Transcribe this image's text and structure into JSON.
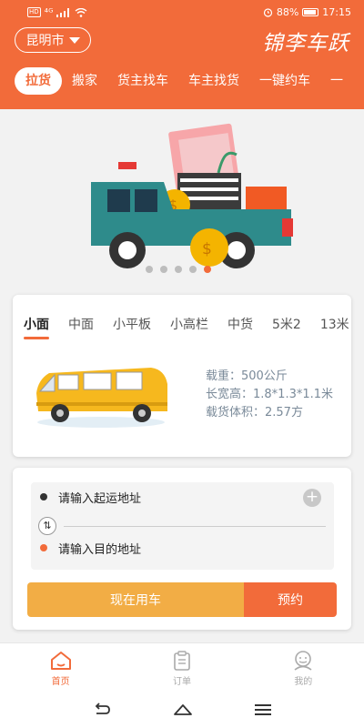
{
  "status_bar": {
    "left_badge": "HD",
    "network": "⁴ᴳ",
    "battery_pct": "88%",
    "time": "17:15"
  },
  "header": {
    "city": "昆明市",
    "brand": "锦李车跃"
  },
  "tabs": [
    {
      "label": "拉货"
    },
    {
      "label": "搬家"
    },
    {
      "label": "货主找车"
    },
    {
      "label": "车主找货"
    },
    {
      "label": "一键约车"
    },
    {
      "label": "一"
    }
  ],
  "carousel": {
    "page_count": 5,
    "active_index": 4
  },
  "vehicle_card": {
    "types": [
      "小面",
      "中面",
      "小平板",
      "小高栏",
      "中货",
      "5米2",
      "13米"
    ],
    "active_type": 0,
    "specs": {
      "load": "载重：500公斤",
      "dimensions": "长宽高：1.8*1.3*1.1米",
      "volume": "载货体积：2.57方"
    }
  },
  "route_card": {
    "from_placeholder": "请输入起运地址",
    "to_placeholder": "请输入目的地址",
    "add_icon": "plus-icon",
    "swap_icon": "swap-icon",
    "use_now_label": "现在用车",
    "book_label": "预约"
  },
  "bottom_nav": [
    {
      "label": "首页",
      "icon": "home-icon",
      "active": true
    },
    {
      "label": "订单",
      "icon": "clipboard-icon",
      "active": false
    },
    {
      "label": "我的",
      "icon": "user-icon",
      "active": false
    }
  ],
  "colors": {
    "accent": "#f26b3a",
    "secondary": "#f2ad45"
  }
}
